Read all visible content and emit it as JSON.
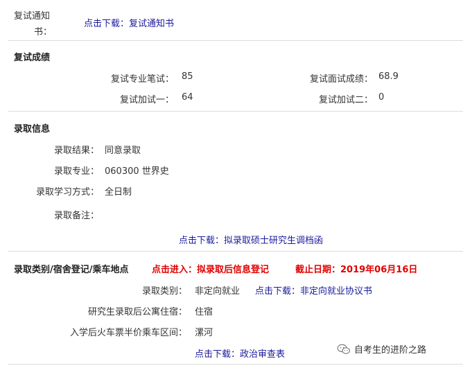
{
  "notice": {
    "label_part1": "复试通知",
    "label_part2": "书：",
    "link": "点击下载：复试通知书"
  },
  "scores": {
    "title": "复试成绩",
    "written_label": "复试专业笔试：",
    "written_value": "85",
    "interview_label": "复试面试成绩：",
    "interview_value": "68.9",
    "extra1_label": "复试加试一：",
    "extra1_value": "64",
    "extra2_label": "复试加试二：",
    "extra2_value": "0"
  },
  "admission": {
    "title": "录取信息",
    "result_label": "录取结果：",
    "result_value": "同意录取",
    "major_label": "录取专业：",
    "major_value": "060300 世界史",
    "mode_label": "录取学习方式：",
    "mode_value": "全日制",
    "note_label": "录取备注：",
    "note_value": "",
    "file_link": "点击下载：拟录取硕士研究生调档函"
  },
  "category": {
    "title": "录取类别/宿舍登记/乘车地点",
    "enter_link": "点击进入：拟录取后信息登记",
    "deadline": "截止日期：2019年06月16日",
    "type_label": "录取类别：",
    "type_value": "非定向就业",
    "agreement_link": "点击下载：非定向就业协议书",
    "dorm_label": "研究生录取后公寓住宿：",
    "dorm_value": "住宿",
    "train_label": "入学后火车票半价乘车区间：",
    "train_value": "漯河",
    "political_link": "点击下载：政治审查表"
  },
  "watermark": {
    "icon": "wechat-icon",
    "text": "自考生的进阶之路"
  },
  "colors": {
    "link": "#1a1a9c",
    "highlight": "#e00000",
    "divider": "#dcdcdc"
  }
}
